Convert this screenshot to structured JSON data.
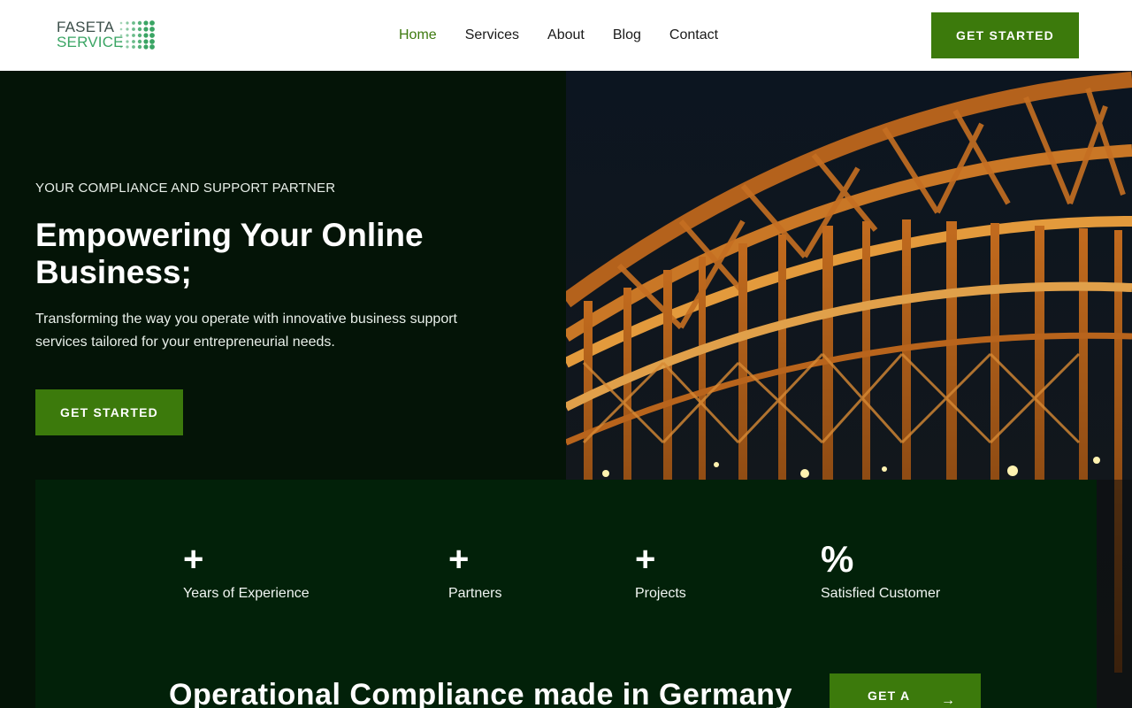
{
  "header": {
    "logo": {
      "line1": "FASETA",
      "line2": "SERVICE"
    },
    "nav": [
      {
        "label": "Home",
        "active": true
      },
      {
        "label": "Services",
        "active": false
      },
      {
        "label": "About",
        "active": false
      },
      {
        "label": "Blog",
        "active": false
      },
      {
        "label": "Contact",
        "active": false
      }
    ],
    "cta_label": "GET STARTED"
  },
  "hero": {
    "eyebrow": "YOUR COMPLIANCE AND SUPPORT PARTNER",
    "title": "Empowering Your Online Business;",
    "description": "Transforming the way you operate with innovative business support services tailored for your entrepreneurial needs.",
    "cta_label": "GET STARTED"
  },
  "stats": [
    {
      "value": "+",
      "label": "Years of Experience"
    },
    {
      "value": "+",
      "label": "Partners"
    },
    {
      "value": "+",
      "label": "Projects"
    },
    {
      "value": "%",
      "label": "Satisfied Customer"
    }
  ],
  "compliance": {
    "title": "Operational Compliance made in Germany",
    "cta_label": "GET A",
    "cta_icon": "arrow-right-icon"
  },
  "colors": {
    "brand_green": "#3c7a0c",
    "hero_bg": "#041407",
    "panel_bg": "#022109",
    "active_nav": "#3d7a0f"
  }
}
